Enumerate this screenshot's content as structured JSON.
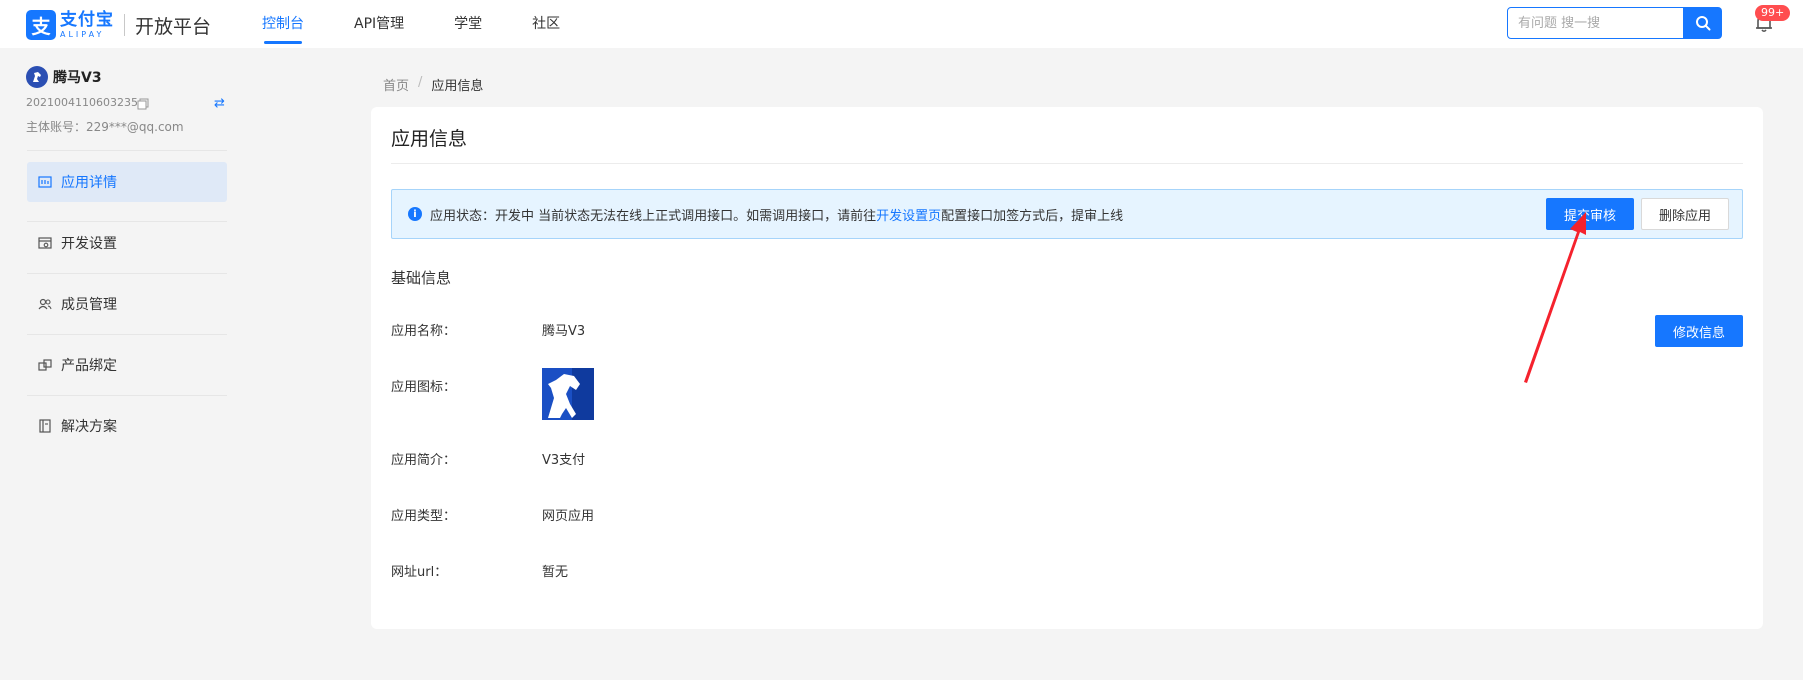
{
  "header": {
    "logo_mark": "支",
    "logo_cn": "支付宝",
    "logo_en": "ALIPAY",
    "logo_title": "开放平台",
    "nav": [
      {
        "label": "控制台"
      },
      {
        "label": "API管理"
      },
      {
        "label": "学堂"
      },
      {
        "label": "社区"
      }
    ],
    "search_placeholder": "有问题 搜一搜",
    "search_icon": "search-icon",
    "notification_icon": "bell-icon",
    "notification_badge": "99+"
  },
  "sidebar": {
    "app_name": "腾马V3",
    "app_id": "2021004110603235",
    "account": "主体账号：229***@qq.com",
    "swap_icon": "⇄",
    "menu": [
      {
        "label": "应用详情",
        "icon": "app-detail-icon"
      },
      {
        "label": "开发设置",
        "icon": "dev-settings-icon"
      },
      {
        "label": "成员管理",
        "icon": "members-icon"
      },
      {
        "label": "产品绑定",
        "icon": "product-bind-icon"
      },
      {
        "label": "解决方案",
        "icon": "solution-icon"
      }
    ]
  },
  "breadcrumb": {
    "home": "首页",
    "separator": "/",
    "current": "应用信息"
  },
  "card": {
    "title": "应用信息",
    "alert": {
      "prefix": "应用状态：开发中 当前状态无法在线上正式调用接口。如需调用接口，请前往",
      "link": "开发设置页",
      "suffix": "配置接口加签方式后，提审上线"
    },
    "submit_button": "提交审核",
    "delete_button": "删除应用",
    "section_title": "基础信息",
    "edit_button": "修改信息",
    "fields": [
      {
        "label": "应用名称：",
        "value": "腾马V3"
      },
      {
        "label": "应用图标：",
        "value": ""
      },
      {
        "label": "应用简介：",
        "value": "V3支付"
      },
      {
        "label": "应用类型：",
        "value": "网页应用"
      },
      {
        "label": "网址url：",
        "value": "暂无"
      }
    ]
  },
  "colors": {
    "primary": "#1677ff",
    "badge": "#ff4d4f",
    "annotation_arrow": "#f5222d"
  }
}
